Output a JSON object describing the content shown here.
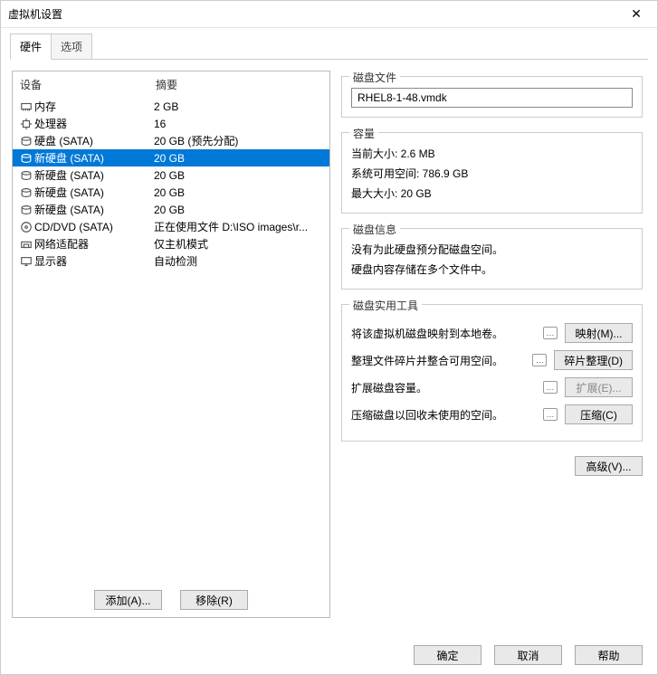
{
  "window": {
    "title": "虚拟机设置",
    "close": "✕"
  },
  "tabs": {
    "hardware": "硬件",
    "options": "选项"
  },
  "columns": {
    "device": "设备",
    "summary": "摘要"
  },
  "devices": [
    {
      "icon": "memory-icon",
      "name": "内存",
      "summary": "2 GB",
      "selected": false
    },
    {
      "icon": "cpu-icon",
      "name": "处理器",
      "summary": "16",
      "selected": false
    },
    {
      "icon": "disk-icon",
      "name": "硬盘 (SATA)",
      "summary": "20 GB (预先分配)",
      "selected": false
    },
    {
      "icon": "disk-icon",
      "name": "新硬盘 (SATA)",
      "summary": "20 GB",
      "selected": true
    },
    {
      "icon": "disk-icon",
      "name": "新硬盘 (SATA)",
      "summary": "20 GB",
      "selected": false
    },
    {
      "icon": "disk-icon",
      "name": "新硬盘 (SATA)",
      "summary": "20 GB",
      "selected": false
    },
    {
      "icon": "disk-icon",
      "name": "新硬盘 (SATA)",
      "summary": "20 GB",
      "selected": false
    },
    {
      "icon": "cd-icon",
      "name": "CD/DVD (SATA)",
      "summary": "正在使用文件 D:\\ISO images\\r...",
      "selected": false
    },
    {
      "icon": "network-icon",
      "name": "网络适配器",
      "summary": "仅主机模式",
      "selected": false
    },
    {
      "icon": "display-icon",
      "name": "显示器",
      "summary": "自动检测",
      "selected": false
    }
  ],
  "leftButtons": {
    "add": "添加(A)...",
    "remove": "移除(R)"
  },
  "diskFile": {
    "groupLabel": "磁盘文件",
    "value": "RHEL8-1-48.vmdk"
  },
  "capacity": {
    "groupLabel": "容量",
    "current": "当前大小: 2.6 MB",
    "free": "系统可用空间: 786.9 GB",
    "max": "最大大小: 20 GB"
  },
  "diskInfo": {
    "groupLabel": "磁盘信息",
    "line1": "没有为此硬盘预分配磁盘空间。",
    "line2": "硬盘内容存储在多个文件中。"
  },
  "utilities": {
    "groupLabel": "磁盘实用工具",
    "map": {
      "text": "将该虚拟机磁盘映射到本地卷。",
      "btn": "映射(M)...",
      "disabled": false
    },
    "defrag": {
      "text": "整理文件碎片并整合可用空间。",
      "btn": "碎片整理(D)",
      "disabled": false
    },
    "expand": {
      "text": "扩展磁盘容量。",
      "btn": "扩展(E)...",
      "disabled": true
    },
    "compact": {
      "text": "压缩磁盘以回收未使用的空间。",
      "btn": "压缩(C)",
      "disabled": false
    }
  },
  "advanced": "高级(V)...",
  "footer": {
    "ok": "确定",
    "cancel": "取消",
    "help": "帮助"
  }
}
